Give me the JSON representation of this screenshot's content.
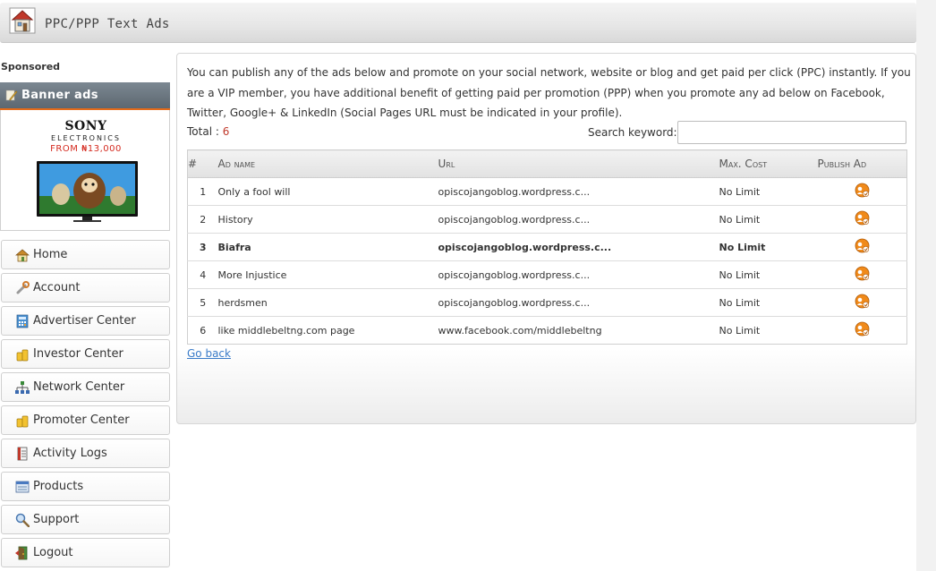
{
  "header": {
    "title": "PPC/PPP Text Ads",
    "icon": "house-icon"
  },
  "sidebar": {
    "sponsored_label": "Sponsored",
    "banner_title": "Banner ads",
    "banner_ad": {
      "brand": "SONY",
      "sub": "ELECTRONICS",
      "price": "FROM ₦13,000"
    },
    "nav": [
      {
        "label": "Home",
        "icon": "home-icon"
      },
      {
        "label": "Account",
        "icon": "wrench-icon"
      },
      {
        "label": "Advertiser Center",
        "icon": "calculator-icon"
      },
      {
        "label": "Investor Center",
        "icon": "coins-icon"
      },
      {
        "label": "Network Center",
        "icon": "network-icon"
      },
      {
        "label": "Promoter Center",
        "icon": "coins-icon"
      },
      {
        "label": "Activity Logs",
        "icon": "log-book-icon"
      },
      {
        "label": "Products",
        "icon": "products-icon"
      },
      {
        "label": "Support",
        "icon": "magnifier-icon"
      },
      {
        "label": "Logout",
        "icon": "door-icon"
      }
    ]
  },
  "main": {
    "intro": "You can publish any of the ads below and promote on your social network, website or blog and get paid per click (PPC) instantly. If you are a VIP member, you have additional benefit of getting paid per promotion (PPP) when you promote any ad below on Facebook, Twitter, Google+ & LinkedIn (Social Pages URL must be indicated in your profile).",
    "total_label": "Total : ",
    "total_count": "6",
    "search_label": "Search keyword:",
    "search_value": "",
    "table": {
      "headers": [
        "#",
        "Ad name",
        "Url",
        "Max. Cost",
        "Publish Ad"
      ],
      "rows": [
        {
          "num": "1",
          "name": "Only a fool will",
          "url": "opiscojangoblog.wordpress.c...",
          "cost": "No Limit",
          "bold": false
        },
        {
          "num": "2",
          "name": "History",
          "url": "opiscojangoblog.wordpress.c...",
          "cost": "No Limit",
          "bold": false
        },
        {
          "num": "3",
          "name": "Biafra",
          "url": "opiscojangoblog.wordpress.c...",
          "cost": "No Limit",
          "bold": true
        },
        {
          "num": "4",
          "name": "More Injustice",
          "url": "opiscojangoblog.wordpress.c...",
          "cost": "No Limit",
          "bold": false
        },
        {
          "num": "5",
          "name": "herdsmen",
          "url": "opiscojangoblog.wordpress.c...",
          "cost": "No Limit",
          "bold": false
        },
        {
          "num": "6",
          "name": "like middlebeltng.com page",
          "url": "www.facebook.com/middlebeltng",
          "cost": "No Limit",
          "bold": false
        }
      ]
    },
    "go_back": "Go back"
  },
  "colors": {
    "link": "#3a7bc8",
    "accent": "#e46b1a",
    "count": "#c0392b"
  }
}
